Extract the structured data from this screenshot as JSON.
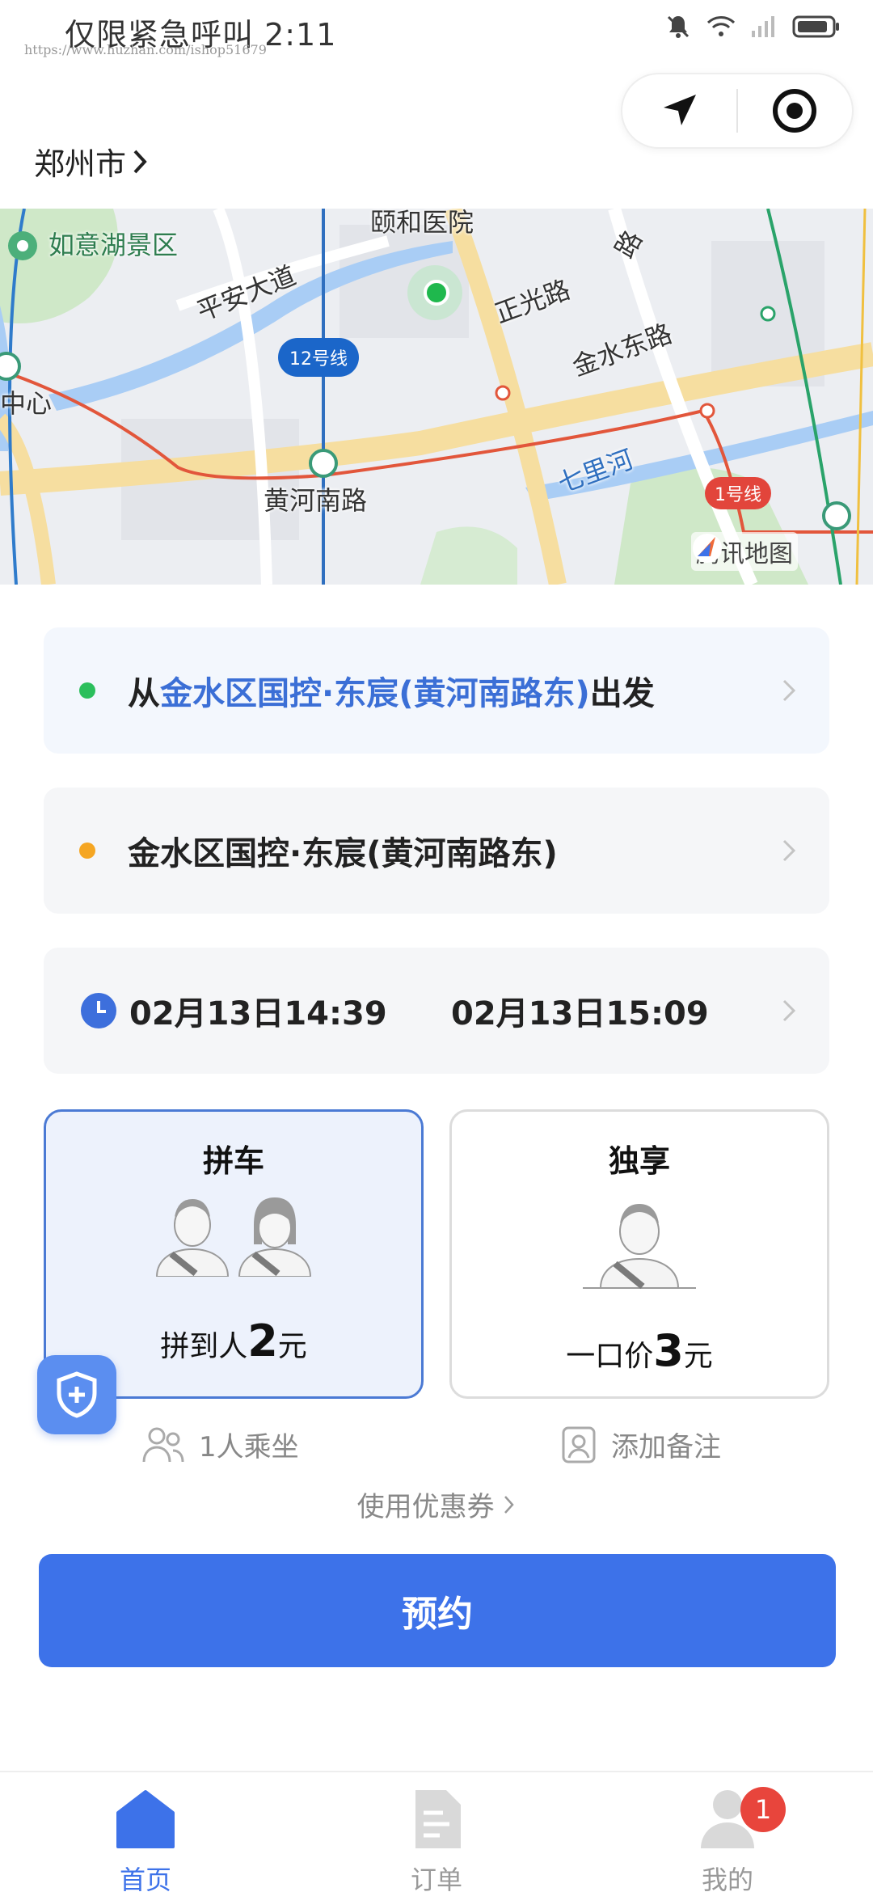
{
  "status_bar": {
    "text": "仅限紧急呼叫 2:11",
    "watermark": "https://www.huzhan.com/ishop51679"
  },
  "header": {
    "city": "郑州市"
  },
  "map": {
    "labels": {
      "scenic": "如意湖景区",
      "hospital": "颐和医院",
      "road_pingan": "平安大道",
      "road_zhengguang": "正光路",
      "road_jinshui": "金水东路",
      "center": "中心",
      "road_huanghe": "黄河南路",
      "river": "七里河",
      "road_nan": "路"
    },
    "line12": "12号线",
    "line1": "1号线",
    "attribution": "腾讯地图"
  },
  "route": {
    "from_prefix": "从",
    "from_place": "金水区国控·东宸(黄河南路东)",
    "from_suffix": "出发",
    "to_place": "金水区国控·东宸(黄河南路东)",
    "time_start": "02月13日14:39",
    "time_end": "02月13日15:09"
  },
  "options": {
    "pool": {
      "title": "拼车",
      "price_prefix": "拼到人",
      "price": "2",
      "price_unit": "元",
      "selected": true
    },
    "solo": {
      "title": "独享",
      "price_prefix": "一口价",
      "price": "3",
      "price_unit": "元",
      "selected": false
    }
  },
  "extras": {
    "passengers": "1人乘坐",
    "note": "添加备注",
    "coupon": "使用优惠券"
  },
  "book_button": "预约",
  "tabs": [
    {
      "label": "首页",
      "icon": "home-icon",
      "active": true
    },
    {
      "label": "订单",
      "icon": "order-icon",
      "active": false
    },
    {
      "label": "我的",
      "icon": "user-icon",
      "active": false,
      "badge": "1"
    }
  ],
  "colors": {
    "accent": "#3d72e9",
    "highlight_text": "#3b6fd6",
    "origin_dot": "#2bbf5c",
    "destination_dot": "#f5a623",
    "badge": "#e8453c"
  }
}
